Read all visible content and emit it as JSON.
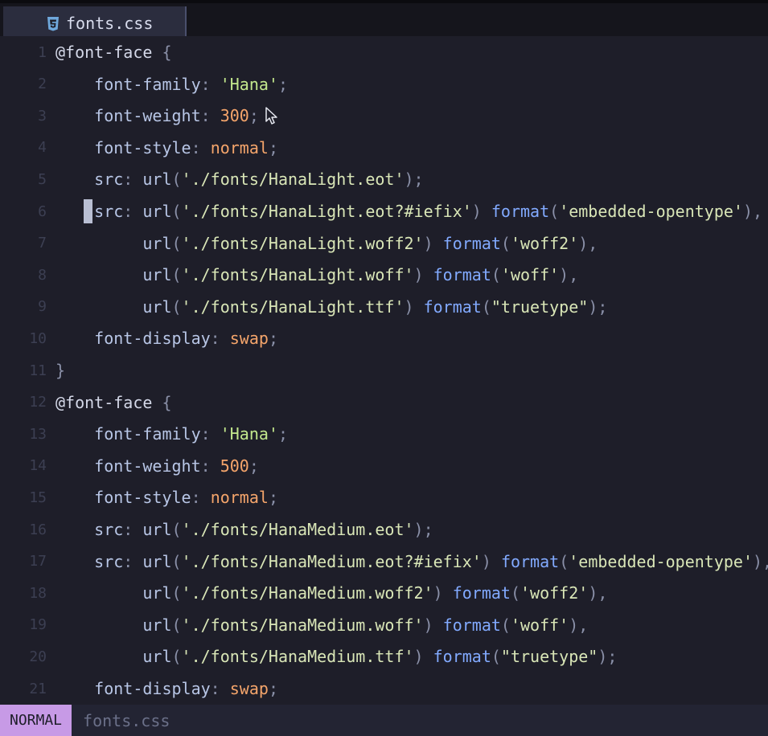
{
  "tab": {
    "icon": "css3-file-icon",
    "label": "fonts.css"
  },
  "status": {
    "mode": "NORMAL",
    "file": "fonts.css"
  },
  "cursor_line": 6,
  "lines": [
    {
      "n": "1",
      "tokens": [
        [
          "at",
          "@font-face"
        ],
        [
          "plain",
          " "
        ],
        [
          "punct",
          "{"
        ]
      ]
    },
    {
      "n": "2",
      "tokens": [
        [
          "plain",
          "    "
        ],
        [
          "prop",
          "font-family"
        ],
        [
          "punct",
          ": "
        ],
        [
          "str",
          "'Hana'"
        ],
        [
          "punct",
          ";"
        ]
      ]
    },
    {
      "n": "3",
      "tokens": [
        [
          "plain",
          "    "
        ],
        [
          "prop",
          "font-weight"
        ],
        [
          "punct",
          ": "
        ],
        [
          "num",
          "300"
        ],
        [
          "punct",
          ";"
        ]
      ]
    },
    {
      "n": "4",
      "tokens": [
        [
          "plain",
          "    "
        ],
        [
          "prop",
          "font-style"
        ],
        [
          "punct",
          ": "
        ],
        [
          "val",
          "normal"
        ],
        [
          "punct",
          ";"
        ]
      ]
    },
    {
      "n": "5",
      "tokens": [
        [
          "plain",
          "    "
        ],
        [
          "prop",
          "src"
        ],
        [
          "punct",
          ": "
        ],
        [
          "prop",
          "url"
        ],
        [
          "punct",
          "("
        ],
        [
          "str2",
          "'./fonts/HanaLight.eot'"
        ],
        [
          "punct",
          ");"
        ]
      ]
    },
    {
      "n": "6",
      "tokens": [
        [
          "plain",
          "    "
        ],
        [
          "prop",
          "src"
        ],
        [
          "punct",
          ": "
        ],
        [
          "prop",
          "url"
        ],
        [
          "punct",
          "("
        ],
        [
          "str2",
          "'./fonts/HanaLight.eot?#iefix'"
        ],
        [
          "punct",
          ") "
        ],
        [
          "fn",
          "format"
        ],
        [
          "punct",
          "("
        ],
        [
          "str2",
          "'embedded-opentype'"
        ],
        [
          "punct",
          "),"
        ]
      ]
    },
    {
      "n": "7",
      "tokens": [
        [
          "plain",
          "         "
        ],
        [
          "prop",
          "url"
        ],
        [
          "punct",
          "("
        ],
        [
          "str2",
          "'./fonts/HanaLight.woff2'"
        ],
        [
          "punct",
          ") "
        ],
        [
          "fn",
          "format"
        ],
        [
          "punct",
          "("
        ],
        [
          "str2",
          "'woff2'"
        ],
        [
          "punct",
          "),"
        ]
      ]
    },
    {
      "n": "8",
      "tokens": [
        [
          "plain",
          "         "
        ],
        [
          "prop",
          "url"
        ],
        [
          "punct",
          "("
        ],
        [
          "str2",
          "'./fonts/HanaLight.woff'"
        ],
        [
          "punct",
          ") "
        ],
        [
          "fn",
          "format"
        ],
        [
          "punct",
          "("
        ],
        [
          "str2",
          "'woff'"
        ],
        [
          "punct",
          "),"
        ]
      ]
    },
    {
      "n": "9",
      "tokens": [
        [
          "plain",
          "         "
        ],
        [
          "prop",
          "url"
        ],
        [
          "punct",
          "("
        ],
        [
          "str2",
          "'./fonts/HanaLight.ttf'"
        ],
        [
          "punct",
          ") "
        ],
        [
          "fn",
          "format"
        ],
        [
          "punct",
          "("
        ],
        [
          "str2",
          "\"truetype\""
        ],
        [
          "punct",
          ");"
        ]
      ]
    },
    {
      "n": "10",
      "tokens": [
        [
          "plain",
          "    "
        ],
        [
          "prop",
          "font-display"
        ],
        [
          "punct",
          ": "
        ],
        [
          "val",
          "swap"
        ],
        [
          "punct",
          ";"
        ]
      ]
    },
    {
      "n": "11",
      "tokens": [
        [
          "punct",
          "}"
        ]
      ]
    },
    {
      "n": "12",
      "tokens": [
        [
          "at",
          "@font-face"
        ],
        [
          "plain",
          " "
        ],
        [
          "punct",
          "{"
        ]
      ]
    },
    {
      "n": "13",
      "tokens": [
        [
          "plain",
          "    "
        ],
        [
          "prop",
          "font-family"
        ],
        [
          "punct",
          ": "
        ],
        [
          "str",
          "'Hana'"
        ],
        [
          "punct",
          ";"
        ]
      ]
    },
    {
      "n": "14",
      "tokens": [
        [
          "plain",
          "    "
        ],
        [
          "prop",
          "font-weight"
        ],
        [
          "punct",
          ": "
        ],
        [
          "num",
          "500"
        ],
        [
          "punct",
          ";"
        ]
      ]
    },
    {
      "n": "15",
      "tokens": [
        [
          "plain",
          "    "
        ],
        [
          "prop",
          "font-style"
        ],
        [
          "punct",
          ": "
        ],
        [
          "val",
          "normal"
        ],
        [
          "punct",
          ";"
        ]
      ]
    },
    {
      "n": "16",
      "tokens": [
        [
          "plain",
          "    "
        ],
        [
          "prop",
          "src"
        ],
        [
          "punct",
          ": "
        ],
        [
          "prop",
          "url"
        ],
        [
          "punct",
          "("
        ],
        [
          "str2",
          "'./fonts/HanaMedium.eot'"
        ],
        [
          "punct",
          ");"
        ]
      ]
    },
    {
      "n": "17",
      "tokens": [
        [
          "plain",
          "    "
        ],
        [
          "prop",
          "src"
        ],
        [
          "punct",
          ": "
        ],
        [
          "prop",
          "url"
        ],
        [
          "punct",
          "("
        ],
        [
          "str2",
          "'./fonts/HanaMedium.eot?#iefix'"
        ],
        [
          "punct",
          ") "
        ],
        [
          "fn",
          "format"
        ],
        [
          "punct",
          "("
        ],
        [
          "str2",
          "'embedded-opentype'"
        ],
        [
          "punct",
          "),"
        ]
      ]
    },
    {
      "n": "18",
      "tokens": [
        [
          "plain",
          "         "
        ],
        [
          "prop",
          "url"
        ],
        [
          "punct",
          "("
        ],
        [
          "str2",
          "'./fonts/HanaMedium.woff2'"
        ],
        [
          "punct",
          ") "
        ],
        [
          "fn",
          "format"
        ],
        [
          "punct",
          "("
        ],
        [
          "str2",
          "'woff2'"
        ],
        [
          "punct",
          "),"
        ]
      ]
    },
    {
      "n": "19",
      "tokens": [
        [
          "plain",
          "         "
        ],
        [
          "prop",
          "url"
        ],
        [
          "punct",
          "("
        ],
        [
          "str2",
          "'./fonts/HanaMedium.woff'"
        ],
        [
          "punct",
          ") "
        ],
        [
          "fn",
          "format"
        ],
        [
          "punct",
          "("
        ],
        [
          "str2",
          "'woff'"
        ],
        [
          "punct",
          "),"
        ]
      ]
    },
    {
      "n": "20",
      "tokens": [
        [
          "plain",
          "         "
        ],
        [
          "prop",
          "url"
        ],
        [
          "punct",
          "("
        ],
        [
          "str2",
          "'./fonts/HanaMedium.ttf'"
        ],
        [
          "punct",
          ") "
        ],
        [
          "fn",
          "format"
        ],
        [
          "punct",
          "("
        ],
        [
          "str2",
          "\"truetype\""
        ],
        [
          "punct",
          ");"
        ]
      ]
    },
    {
      "n": "21",
      "tokens": [
        [
          "plain",
          "    "
        ],
        [
          "prop",
          "font-display"
        ],
        [
          "punct",
          ": "
        ],
        [
          "val",
          "swap"
        ],
        [
          "punct",
          ";"
        ]
      ]
    }
  ]
}
